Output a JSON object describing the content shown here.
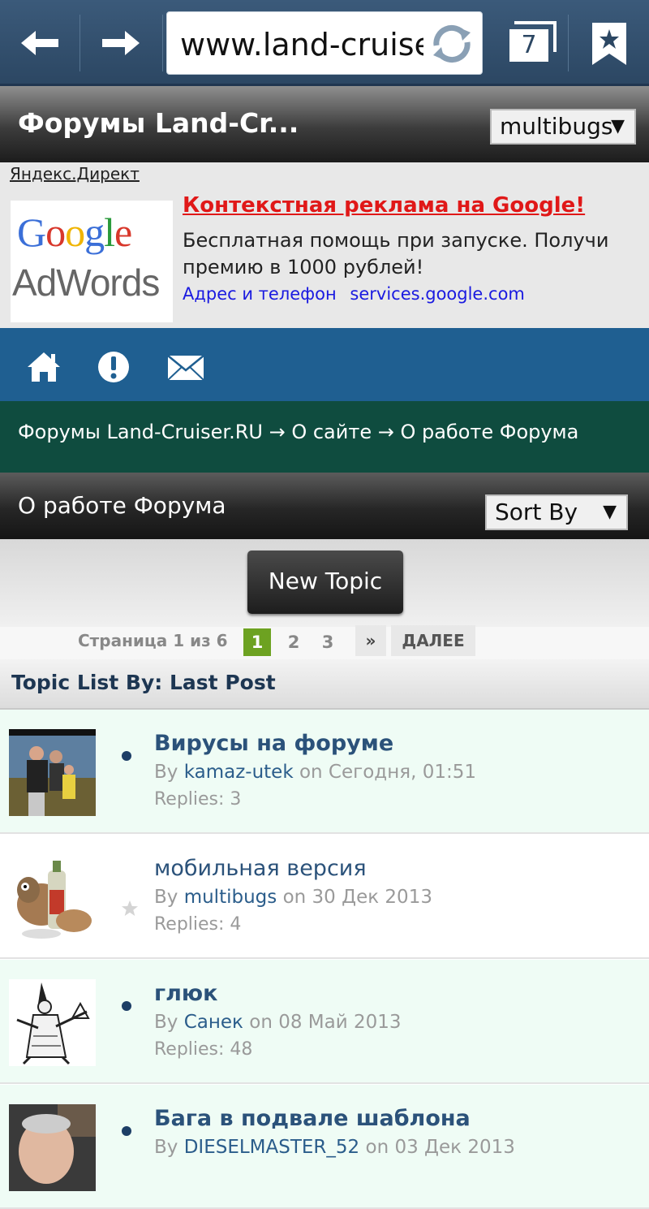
{
  "browser": {
    "url": "www.land-cruiser.ru",
    "tabs_count": "7"
  },
  "forum_header": {
    "title": "Форумы Land-Cr...",
    "user_select": "multibugs"
  },
  "ad": {
    "source": "Яндекс.Директ",
    "logo_line1": "Google",
    "logo_line2": "AdWords",
    "headline": "Контекстная реклама на Google!",
    "body": "Бесплатная помощь при запуске. Получи премию в 1000 рублей!",
    "link_address": "Адрес и телефон",
    "link_domain": "services.google.com"
  },
  "breadcrumb": "Форумы Land-Cruiser.RU → О сайте → О работе Форума",
  "section": {
    "title": "О работе Форума",
    "sort_label": "Sort By"
  },
  "new_topic_label": "New Topic",
  "pagination": {
    "info": "Страница 1 из 6",
    "pages": [
      "1",
      "2",
      "3"
    ],
    "next": "»",
    "further": "ДАЛЕЕ"
  },
  "list_header": "Topic List By: Last Post",
  "topics": [
    {
      "title": "Вирусы на форуме",
      "by": "By",
      "author": "kamaz-utek",
      "on": "on Сегодня, 01:51",
      "replies": "Replies: 3"
    },
    {
      "title": "мобильная версия",
      "by": "By",
      "author": "multibugs",
      "on": "on 30 Дек 2013",
      "replies": "Replies: 4"
    },
    {
      "title": "глюк",
      "by": "By",
      "author": "Санек",
      "on": "on 08 Май 2013",
      "replies": "Replies: 48"
    },
    {
      "title": "Бага в подвале шаблона",
      "by": "By",
      "author": "DIESELMASTER_52",
      "on": "on 03 Дек 2013",
      "replies": ""
    }
  ],
  "colors": {
    "browser_bar": "#2c4763",
    "icon_bar": "#1f5f91",
    "breadcrumb_bg": "#0f4c3f",
    "ad_headline": "#e01818",
    "ad_link": "#1a1ae0",
    "active_page": "#6da221",
    "topic_title": "#2b527a",
    "unread_bg": "#effcf5"
  },
  "icons": [
    "back-arrow-icon",
    "forward-arrow-icon",
    "reload-icon",
    "tabs-icon",
    "bookmark-icon",
    "home-icon",
    "alert-icon",
    "mail-icon",
    "unread-dot-icon",
    "star-icon"
  ]
}
